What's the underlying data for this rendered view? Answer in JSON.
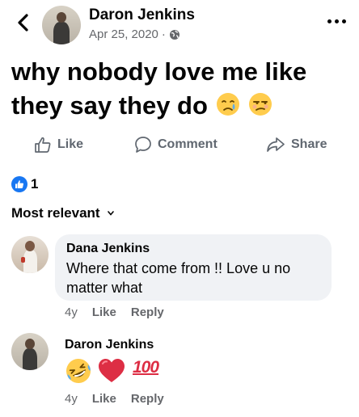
{
  "post": {
    "author": "Daron Jenkins",
    "date": "Apr 25, 2020",
    "separator": "·",
    "privacy_icon": "globe-icon",
    "text_line1": "why nobody love me like",
    "text_line2": "they say they do",
    "emojis": [
      "crying-face-emoji",
      "unamused-face-emoji"
    ]
  },
  "actions": {
    "like_label": "Like",
    "comment_label": "Comment",
    "share_label": "Share"
  },
  "reactions": {
    "count": "1",
    "icon": "like-icon",
    "color": "#1877f2"
  },
  "sort": {
    "label": "Most relevant"
  },
  "comments": [
    {
      "author": "Dana Jenkins",
      "text_line1": "Where that come from !! Love u no",
      "text_line2": "matter what",
      "time": "4y",
      "like_label": "Like",
      "reply_label": "Reply"
    },
    {
      "author": "Daron Jenkins",
      "emojis": [
        "rolling-laughing-emoji",
        "red-heart-emoji",
        "hundred-points-emoji"
      ],
      "hundred_text": "100",
      "time": "4y",
      "like_label": "Like",
      "reply_label": "Reply"
    }
  ],
  "colors": {
    "text": "#050505",
    "secondary": "#65676b",
    "bubble": "#f0f2f5",
    "accent": "#1877f2"
  }
}
